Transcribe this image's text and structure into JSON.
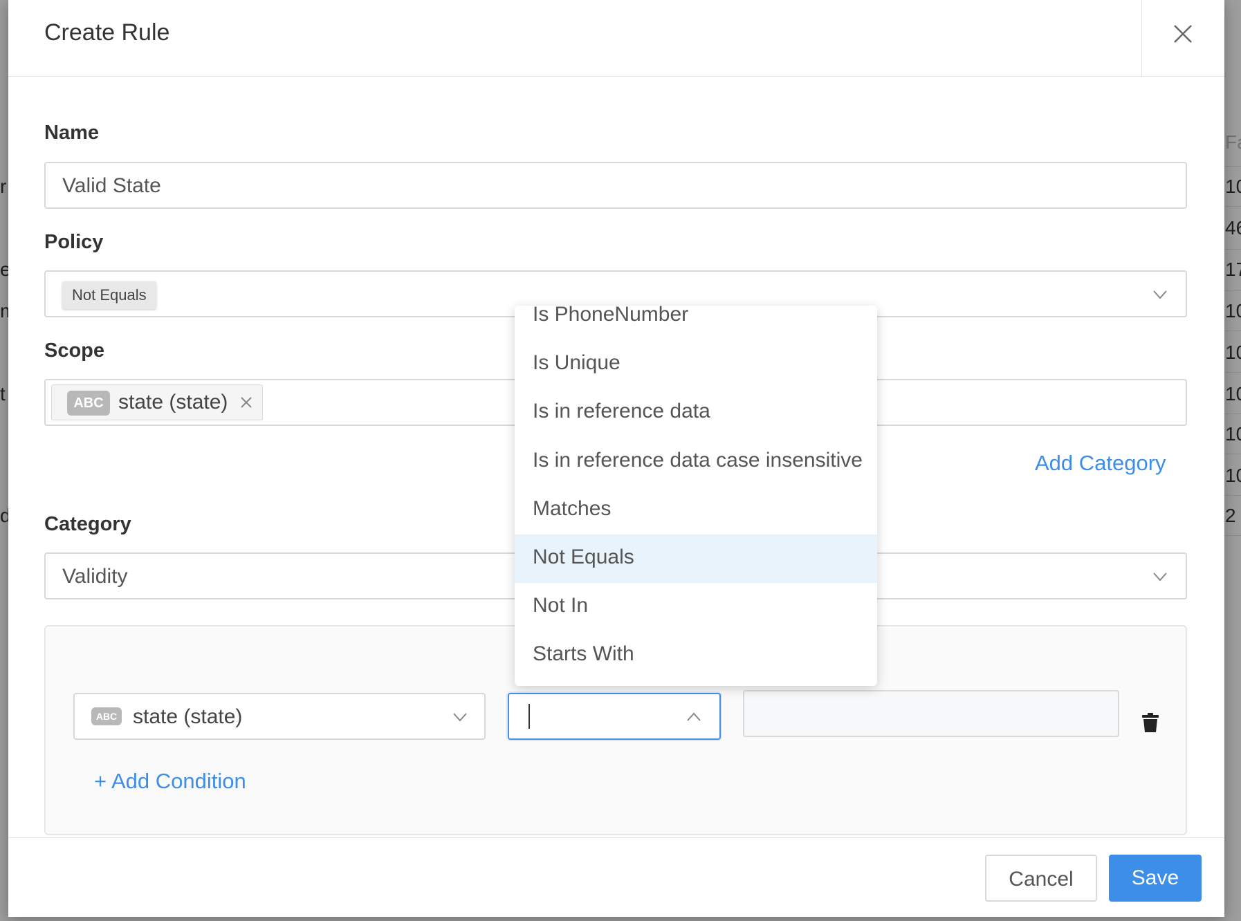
{
  "background": {
    "right_column": [
      "Fa",
      "10",
      "46",
      "17",
      "10",
      "10",
      "10",
      "10",
      "10",
      "2"
    ],
    "left_column": [
      "r",
      "es",
      "m",
      "t",
      "d"
    ]
  },
  "modal": {
    "title": "Create Rule",
    "close_icon": "close-icon"
  },
  "form": {
    "name_label": "Name",
    "name_value": "Valid State",
    "policy_label": "Policy",
    "policy_value": "Not Equals",
    "scope_label": "Scope",
    "scope_chip_type": "ABC",
    "scope_chip_text": "state (state)",
    "add_category_link": "Add Category",
    "category_label": "Category",
    "category_value": "Validity"
  },
  "condition": {
    "column_type": "ABC",
    "column_value": "state (state)",
    "operator_value": "",
    "value_value": "",
    "add_condition_link": "+ Add Condition"
  },
  "dropdown": {
    "options": [
      "Is PhoneNumber",
      "Is Unique",
      "Is in reference data",
      "Is in reference data case insensitive",
      "Matches",
      "Not Equals",
      "Not In",
      "Starts With"
    ],
    "selected": "Not Equals"
  },
  "footer": {
    "cancel_label": "Cancel",
    "save_label": "Save"
  },
  "colors": {
    "accent": "#3c8ee8",
    "selected_option_bg": "#e8f3fb",
    "focus_border": "#4a90e2"
  }
}
